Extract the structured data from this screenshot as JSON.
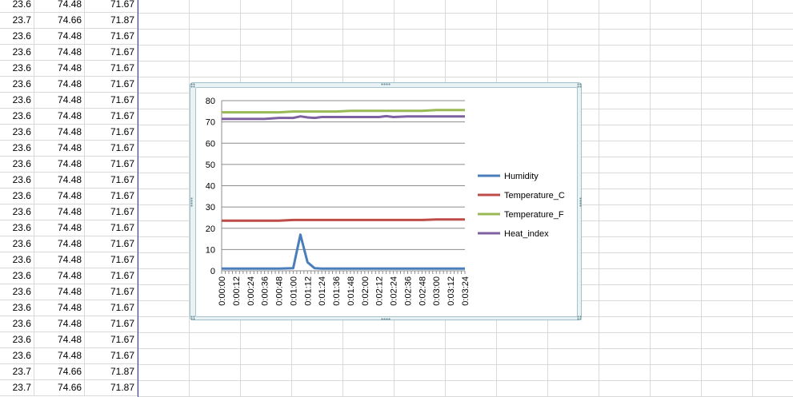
{
  "sheet": {
    "rows": [
      [
        "23.6",
        "74.48",
        "71.67"
      ],
      [
        "23.7",
        "74.66",
        "71.87"
      ],
      [
        "23.6",
        "74.48",
        "71.67"
      ],
      [
        "23.6",
        "74.48",
        "71.67"
      ],
      [
        "23.6",
        "74.48",
        "71.67"
      ],
      [
        "23.6",
        "74.48",
        "71.67"
      ],
      [
        "23.6",
        "74.48",
        "71.67"
      ],
      [
        "23.6",
        "74.48",
        "71.67"
      ],
      [
        "23.6",
        "74.48",
        "71.67"
      ],
      [
        "23.6",
        "74.48",
        "71.67"
      ],
      [
        "23.6",
        "74.48",
        "71.67"
      ],
      [
        "23.6",
        "74.48",
        "71.67"
      ],
      [
        "23.6",
        "74.48",
        "71.67"
      ],
      [
        "23.6",
        "74.48",
        "71.67"
      ],
      [
        "23.6",
        "74.48",
        "71.67"
      ],
      [
        "23.6",
        "74.48",
        "71.67"
      ],
      [
        "23.6",
        "74.48",
        "71.67"
      ],
      [
        "23.6",
        "74.48",
        "71.67"
      ],
      [
        "23.6",
        "74.48",
        "71.67"
      ],
      [
        "23.6",
        "74.48",
        "71.67"
      ],
      [
        "23.6",
        "74.48",
        "71.67"
      ],
      [
        "23.6",
        "74.48",
        "71.67"
      ],
      [
        "23.6",
        "74.48",
        "71.67"
      ],
      [
        "23.7",
        "74.66",
        "71.87"
      ],
      [
        "23.7",
        "74.66",
        "71.87"
      ]
    ]
  },
  "chart_data": {
    "type": "line",
    "title": "",
    "xlabel": "",
    "ylabel": "",
    "ylim": [
      0,
      80
    ],
    "yticks": [
      0,
      10,
      20,
      30,
      40,
      50,
      60,
      70,
      80
    ],
    "grid": true,
    "legend_position": "right",
    "x_ticks": [
      "0:00:00",
      "0:00:12",
      "0:00:24",
      "0:00:36",
      "0:00:48",
      "0:01:00",
      "0:01:12",
      "0:01:24",
      "0:01:36",
      "0:01:48",
      "0:02:00",
      "0:02:12",
      "0:02:24",
      "0:02:36",
      "0:02:48",
      "0:03:00",
      "0:03:12",
      "0:03:24"
    ],
    "x": [
      0,
      12,
      24,
      36,
      48,
      60,
      66,
      72,
      78,
      84,
      96,
      108,
      120,
      132,
      138,
      144,
      156,
      168,
      180,
      192,
      204
    ],
    "series": [
      {
        "name": "Humidity",
        "color": "#4a7ebb",
        "values": [
          1,
          1,
          1,
          1,
          1,
          1.2,
          17,
          4,
          1.2,
          1,
          1,
          1,
          1,
          1,
          1,
          1,
          1,
          1,
          1,
          1,
          1
        ]
      },
      {
        "name": "Temperature_C",
        "color": "#be4b48",
        "values": [
          23.6,
          23.6,
          23.6,
          23.6,
          23.6,
          23.9,
          23.9,
          23.9,
          23.9,
          23.9,
          23.9,
          23.9,
          23.9,
          23.9,
          23.9,
          23.9,
          23.9,
          23.9,
          24.1,
          24.1,
          24.1
        ]
      },
      {
        "name": "Temperature_F",
        "color": "#98b954",
        "values": [
          74.5,
          74.5,
          74.5,
          74.5,
          74.5,
          74.9,
          74.9,
          74.9,
          74.9,
          74.9,
          74.9,
          75.2,
          75.2,
          75.2,
          75.2,
          75.2,
          75.2,
          75.2,
          75.6,
          75.6,
          75.6
        ]
      },
      {
        "name": "Heat_index",
        "color": "#7d60a0",
        "values": [
          71.4,
          71.4,
          71.4,
          71.4,
          71.9,
          71.9,
          72.6,
          72.1,
          71.9,
          72.3,
          72.3,
          72.3,
          72.3,
          72.3,
          72.7,
          72.3,
          72.6,
          72.6,
          72.6,
          72.6,
          72.6
        ]
      }
    ]
  }
}
